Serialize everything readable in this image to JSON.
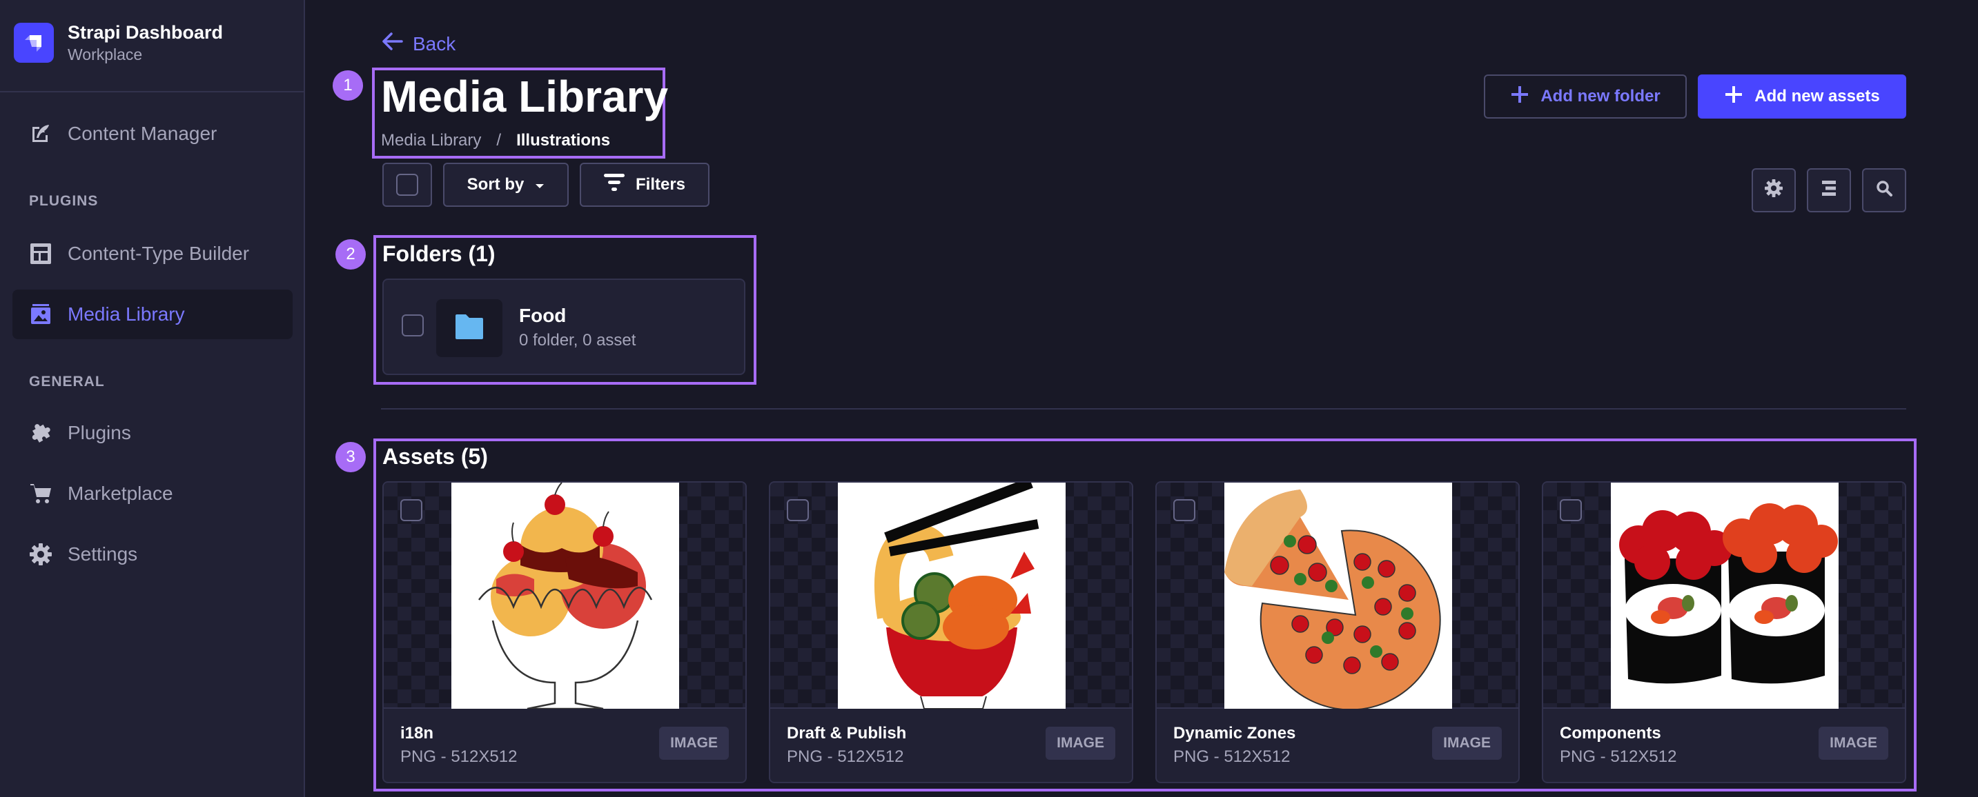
{
  "app": {
    "title": "Strapi Dashboard",
    "subtitle": "Workplace"
  },
  "sidebar": {
    "items": [
      {
        "label": "Content Manager",
        "icon": "feather-icon"
      },
      {
        "label": "Content-Type Builder",
        "icon": "layout-icon"
      },
      {
        "label": "Media Library",
        "icon": "image-icon",
        "active": true
      },
      {
        "label": "Plugins",
        "icon": "puzzle-icon"
      },
      {
        "label": "Marketplace",
        "icon": "cart-icon"
      },
      {
        "label": "Settings",
        "icon": "gear-icon"
      }
    ],
    "sections": {
      "plugins": "PLUGINS",
      "general": "GENERAL"
    }
  },
  "header": {
    "back_label": "Back",
    "title": "Media Library",
    "breadcrumb": {
      "root": "Media Library",
      "separator": "/",
      "current": "Illustrations"
    },
    "add_folder_label": "Add new folder",
    "add_assets_label": "Add new assets"
  },
  "toolbar": {
    "sort_label": "Sort by",
    "filters_label": "Filters"
  },
  "annotations": [
    "1",
    "2",
    "3"
  ],
  "folders": {
    "heading": "Folders (1)",
    "items": [
      {
        "name": "Food",
        "meta": "0 folder, 0 asset"
      }
    ]
  },
  "assets": {
    "heading": "Assets (5)",
    "items": [
      {
        "name": "i18n",
        "meta": "PNG - 512X512",
        "type": "IMAGE",
        "illustration": "ice-cream-sundae"
      },
      {
        "name": "Draft & Publish",
        "meta": "PNG - 512X512",
        "type": "IMAGE",
        "illustration": "noodle-bowl"
      },
      {
        "name": "Dynamic Zones",
        "meta": "PNG - 512X512",
        "type": "IMAGE",
        "illustration": "pizza"
      },
      {
        "name": "Components",
        "meta": "PNG - 512X512",
        "type": "IMAGE",
        "illustration": "sushi-rolls"
      }
    ]
  },
  "colors": {
    "accent": "#4945ff",
    "accent_text": "#7b79ff",
    "highlight": "#a76cf6",
    "folder_icon": "#66b7f1"
  }
}
